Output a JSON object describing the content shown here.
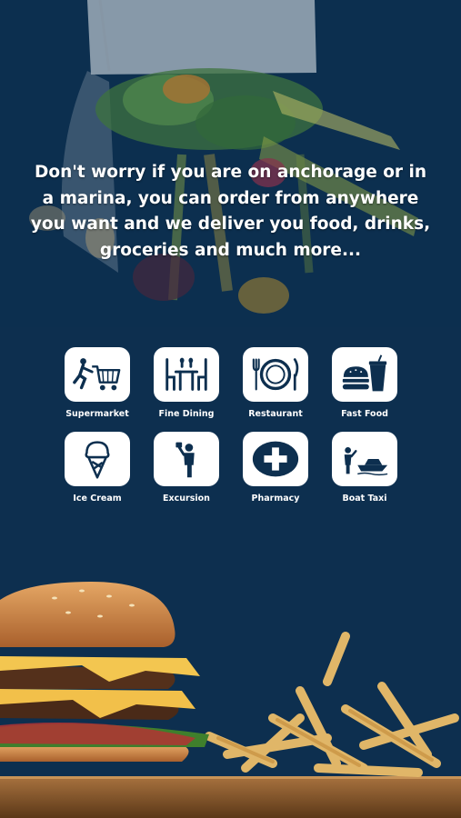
{
  "hero": {
    "message": "Don't worry if you are on anchorage or in a marina, you can order from anywhere you want and we deliver you food, drinks, groceries and much more..."
  },
  "services": [
    {
      "label": "Supermarket",
      "icon": "shopping-cart-icon"
    },
    {
      "label": "Fine Dining",
      "icon": "dining-table-icon"
    },
    {
      "label": "Restaurant",
      "icon": "plate-cutlery-icon"
    },
    {
      "label": "Fast Food",
      "icon": "burger-drink-icon"
    },
    {
      "label": "Ice Cream",
      "icon": "ice-cream-icon"
    },
    {
      "label": "Excursion",
      "icon": "tour-guide-icon"
    },
    {
      "label": "Pharmacy",
      "icon": "medical-cross-icon"
    },
    {
      "label": "Boat Taxi",
      "icon": "boat-icon"
    }
  ],
  "colors": {
    "background": "#0d2f4f",
    "text": "#ffffff",
    "icon_box": "#ffffff",
    "icon": "#0d2f4f"
  }
}
